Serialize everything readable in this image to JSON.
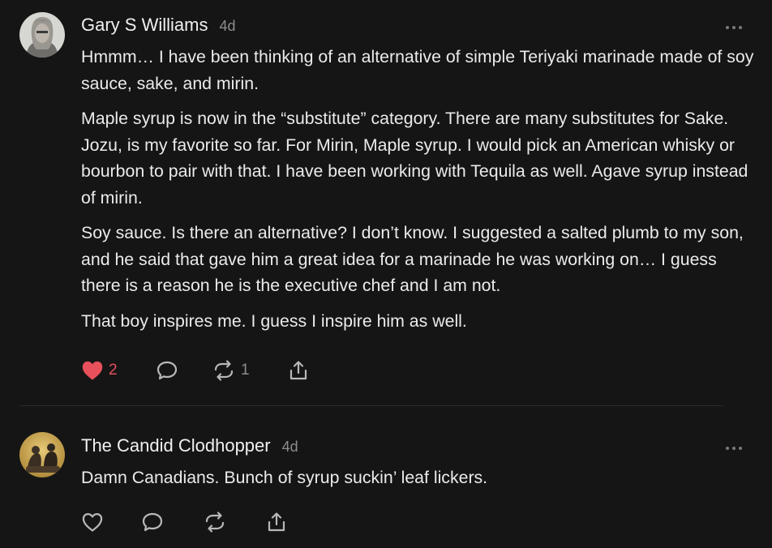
{
  "comments": [
    {
      "author": "Gary S Williams",
      "time": "4d",
      "paragraphs": [
        "Hmmm… I have been thinking of an alternative of simple Teriyaki marinade made of soy sauce, sake, and mirin.",
        "Maple syrup is now in the “substitute” category. There are many substitutes for Sake. Jozu, is my favorite so far. For Mirin, Maple syrup. I would pick an American whisky or bourbon to pair with that. I have been working with Tequila as well. Agave syrup instead of mirin.",
        "Soy sauce. Is there an alternative? I don’t know. I suggested a salted plumb to my son, and he said that gave him a great idea for a marinade he was working on… I guess there is a reason he is the executive chef and I am not.",
        "That boy inspires me. I guess I inspire him as well."
      ],
      "likes": "2",
      "liked": true,
      "restacks": "1"
    },
    {
      "author": "The Candid Clodhopper",
      "time": "4d",
      "paragraphs": [
        "Damn Canadians. Bunch of syrup suckin’ leaf lickers."
      ],
      "likes": "",
      "liked": false,
      "restacks": ""
    }
  ],
  "colors": {
    "background": "#151515",
    "text": "#ebebeb",
    "muted": "#8d8d8d",
    "like": "#e8505b"
  }
}
